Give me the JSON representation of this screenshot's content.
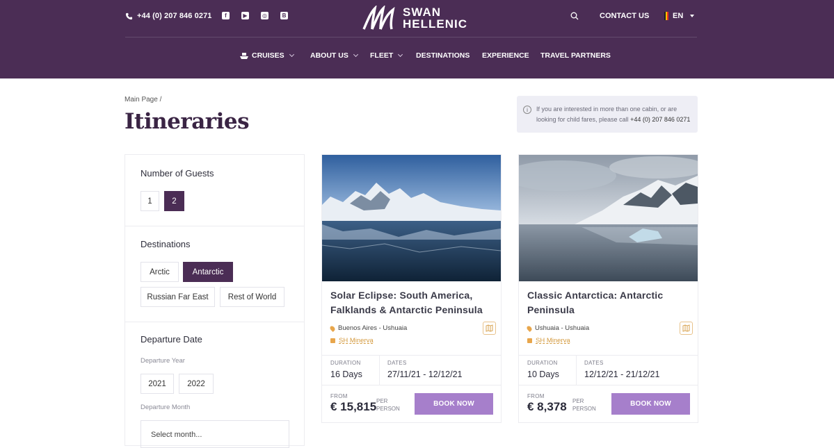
{
  "header": {
    "phone": "+44 (0) 207 846 0271",
    "socials": [
      "facebook-icon",
      "youtube-icon",
      "instagram-icon",
      "vk-icon"
    ],
    "logo_line1": "SWAN",
    "logo_line2": "HELLENIC",
    "contact": "CONTACT US",
    "lang": "EN",
    "nav": [
      {
        "label": "CRUISES",
        "dropdown": true
      },
      {
        "label": "ABOUT US",
        "dropdown": true
      },
      {
        "label": "FLEET",
        "dropdown": true
      },
      {
        "label": "DESTINATIONS",
        "dropdown": false
      },
      {
        "label": "EXPERIENCE",
        "dropdown": false
      },
      {
        "label": "TRAVEL PARTNERS",
        "dropdown": false
      }
    ],
    "bg_color": "#4b2d55"
  },
  "breadcrumb": "Main Page /",
  "page_title": "Itineraries",
  "notice": {
    "text": "If you are interested in more than one cabin, or are looking for child fares, please call",
    "phone": "+44 (0) 207 846 0271"
  },
  "filters": {
    "guests": {
      "title": "Number of Guests",
      "options": [
        "1",
        "2"
      ],
      "selected": "2"
    },
    "destinations": {
      "title": "Destinations",
      "options": [
        "Arctic",
        "Antarctic",
        "Russian Far East",
        "Rest of World"
      ],
      "selected": "Antarctic"
    },
    "departure": {
      "title": "Departure Date",
      "year_label": "Departure Year",
      "years": [
        "2021",
        "2022"
      ],
      "month_label": "Departure Month",
      "month_placeholder": "Select month..."
    }
  },
  "cards": [
    {
      "title": "Solar Eclipse: South America, Falklands & Antarctic Peninsula",
      "route": "Buenos Aires - Ushuaia",
      "ship": "SH Minerva",
      "duration_label": "DURATION",
      "duration": "16 Days",
      "dates_label": "DATES",
      "dates": "27/11/21 - 12/12/21",
      "from_label": "FROM",
      "price": "€ 15,815",
      "per_person": "PER PERSON",
      "book": "BOOK NOW"
    },
    {
      "title": "Classic Antarctica: Antarctic Peninsula",
      "route": "Ushuaia - Ushuaia",
      "ship": "SH Minerva",
      "duration_label": "DURATION",
      "duration": "10 Days",
      "dates_label": "DATES",
      "dates": "12/12/21 - 21/12/21",
      "from_label": "FROM",
      "price": "€ 8,378",
      "per_person": "PER PERSON",
      "book": "BOOK NOW"
    }
  ],
  "accent_color": "#a67fcb"
}
